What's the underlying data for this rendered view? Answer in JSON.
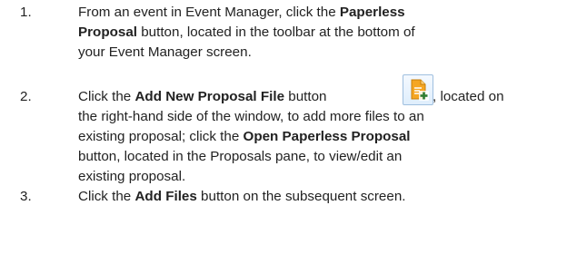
{
  "steps": [
    {
      "number": "1.",
      "lines": [
        {
          "a": "From an event in Event Manager, click the ",
          "b": "Paperless"
        },
        {
          "a": "",
          "b": "Proposal",
          "c": " button, located in the toolbar at the bottom of"
        },
        {
          "a": "your Event Manager screen."
        }
      ]
    },
    {
      "number": "2.",
      "lines": [
        {
          "a": "Click the ",
          "b": "Add New Proposal File",
          "c": " button ",
          "d": ", located on"
        },
        {
          "a": "the right-hand side of the window, to add more files to an"
        },
        {
          "a": "existing proposal; click the ",
          "b": "Open Paperless Proposal"
        },
        {
          "a": "button, located in the Proposals pane, to view/edit an"
        },
        {
          "a": "existing proposal."
        }
      ]
    },
    {
      "number": "3.",
      "lines": [
        {
          "a": "Click the ",
          "b": "Add Files",
          "c": " button on the subsequent screen."
        }
      ]
    }
  ],
  "icons": {
    "add_file": "add-proposal-file-icon"
  },
  "colors": {
    "icon_page": "#f5a623",
    "icon_plus": "#2e7d32",
    "icon_border": "#9fbfdf"
  }
}
